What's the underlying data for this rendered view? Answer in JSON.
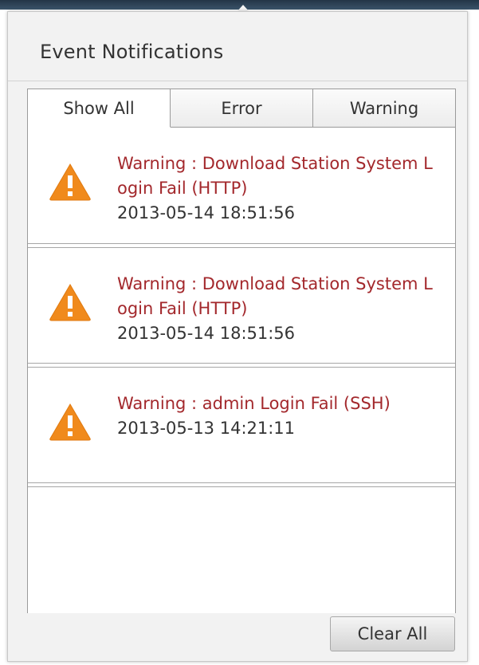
{
  "panel": {
    "title": "Event Notifications"
  },
  "tabs": [
    {
      "label": "Show All",
      "active": true
    },
    {
      "label": "Error",
      "active": false
    },
    {
      "label": "Warning",
      "active": false
    }
  ],
  "events": [
    {
      "icon": "warning-triangle-icon",
      "message": "Warning : Download Station System Login Fail (HTTP)",
      "timestamp": "2013-05-14 18:51:56"
    },
    {
      "icon": "warning-triangle-icon",
      "message": "Warning : Download Station System Login Fail (HTTP)",
      "timestamp": "2013-05-14 18:51:56"
    },
    {
      "icon": "warning-triangle-icon",
      "message": "Warning : admin Login Fail (SSH)",
      "timestamp": "2013-05-13 14:21:11"
    }
  ],
  "actions": {
    "clear_all_label": "Clear All"
  },
  "colors": {
    "warning_text": "#a3282c",
    "warning_icon": "#f08a1c",
    "header_bar": "#2b3f52"
  }
}
